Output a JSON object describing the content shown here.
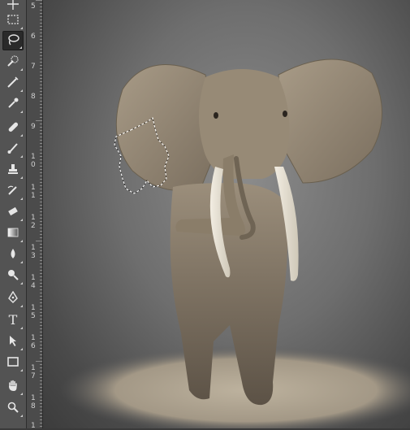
{
  "toolbar": {
    "tools": [
      {
        "name": "move-tool",
        "icon": "move-icon",
        "active": false
      },
      {
        "name": "marquee-tool",
        "icon": "rectangular-marquee-icon",
        "active": false
      },
      {
        "name": "lasso-tool",
        "icon": "lasso-icon",
        "active": true
      },
      {
        "name": "quick-selection-tool",
        "icon": "quick-selection-icon",
        "active": false
      },
      {
        "name": "crop-tool",
        "icon": "crop-icon",
        "active": false
      },
      {
        "name": "eyedropper-tool",
        "icon": "eyedropper-icon",
        "active": false
      },
      {
        "name": "healing-brush-tool",
        "icon": "bandage-icon",
        "active": false
      },
      {
        "name": "brush-tool",
        "icon": "brush-icon",
        "active": false
      },
      {
        "name": "clone-stamp-tool",
        "icon": "stamp-icon",
        "active": false
      },
      {
        "name": "history-brush-tool",
        "icon": "history-brush-icon",
        "active": false
      },
      {
        "name": "eraser-tool",
        "icon": "eraser-icon",
        "active": false
      },
      {
        "name": "gradient-tool",
        "icon": "gradient-icon",
        "active": false
      },
      {
        "name": "blur-tool",
        "icon": "blur-drop-icon",
        "active": false
      },
      {
        "name": "dodge-tool",
        "icon": "dodge-icon",
        "active": false
      },
      {
        "name": "pen-tool",
        "icon": "pen-icon",
        "active": false
      },
      {
        "name": "type-tool",
        "icon": "type-icon",
        "label": "T",
        "active": false
      },
      {
        "name": "path-selection-tool",
        "icon": "path-selection-arrow-icon",
        "active": false
      },
      {
        "name": "rectangle-tool",
        "icon": "rectangle-shape-icon",
        "active": false
      },
      {
        "name": "hand-tool",
        "icon": "hand-icon",
        "active": false
      },
      {
        "name": "zoom-tool",
        "icon": "zoom-icon",
        "active": false
      }
    ]
  },
  "ruler": {
    "labels": [
      "5",
      "6",
      "7",
      "8",
      "9",
      "1\n0",
      "1\n1",
      "1\n2",
      "1\n3",
      "1\n4",
      "1\n5",
      "1\n6",
      "1\n7",
      "1\n8",
      "1"
    ]
  },
  "canvas": {
    "subject": "elephant-photo",
    "selection": "lasso-selection"
  },
  "colors": {
    "toolbar_bg": "#535353",
    "ruler_bg": "#4b4b4b",
    "active_tool_bg": "#2a2a2a"
  }
}
